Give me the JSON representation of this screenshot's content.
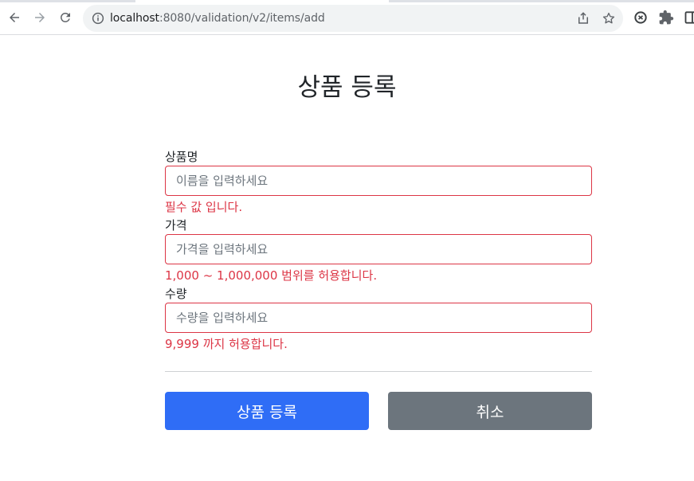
{
  "browser": {
    "url_host": "localhost",
    "url_rest": ":8080/validation/v2/items/add"
  },
  "page": {
    "title": "상품 등록"
  },
  "form": {
    "fields": [
      {
        "label": "상품명",
        "placeholder": "이름을 입력하세요",
        "value": "",
        "error": "필수 값 입니다."
      },
      {
        "label": "가격",
        "placeholder": "가격을 입력하세요",
        "value": "",
        "error": "1,000 ~ 1,000,000 범위를 허용합니다."
      },
      {
        "label": "수량",
        "placeholder": "수량을 입력하세요",
        "value": "",
        "error": "9,999 까지 허용합니다."
      }
    ],
    "submit_label": "상품 등록",
    "cancel_label": "취소"
  },
  "colors": {
    "error": "#dc3545",
    "primary": "#2f6df6",
    "secondary": "#6c757d"
  },
  "icons": [
    "back-arrow-icon",
    "forward-arrow-icon",
    "reload-icon",
    "info-icon",
    "share-icon",
    "star-icon",
    "sync-extension-icon",
    "puzzle-extension-icon",
    "side-panel-icon"
  ]
}
